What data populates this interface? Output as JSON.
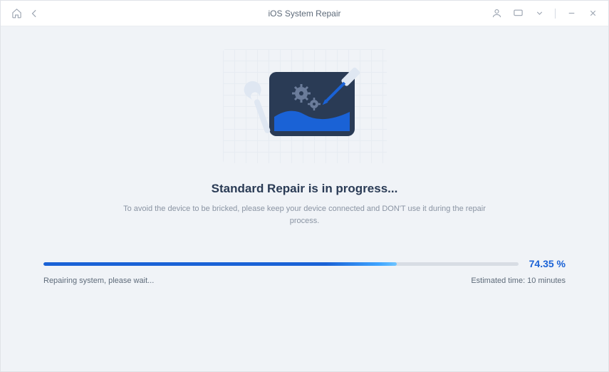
{
  "titlebar": {
    "title": "iOS System Repair"
  },
  "main": {
    "heading": "Standard Repair is in progress...",
    "subtext": "To avoid the device to be bricked, please keep your device connected and DON'T use it during the repair process."
  },
  "progress": {
    "percent_value": 74.35,
    "percent_label": "74.35 %",
    "fill_width": "74.35%",
    "status_left": "Repairing system, please wait...",
    "status_right": "Estimated time: 10 minutes"
  }
}
